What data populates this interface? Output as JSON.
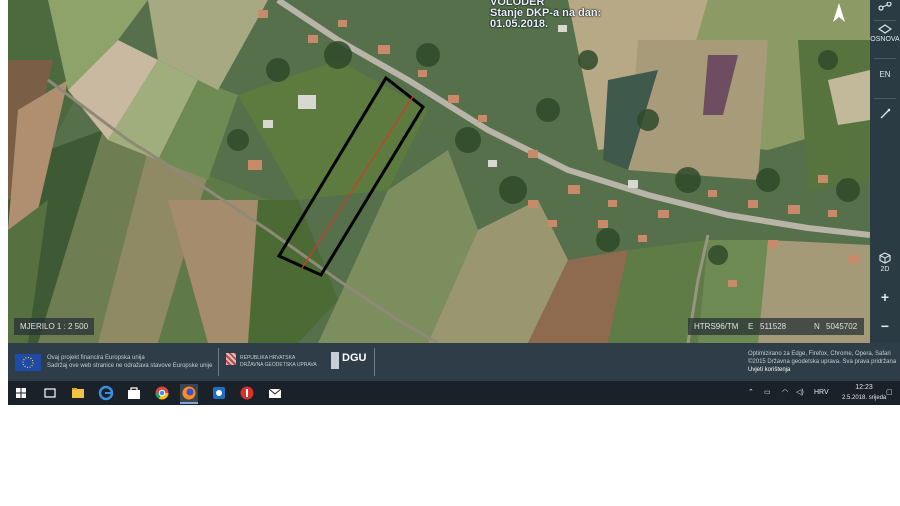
{
  "map": {
    "title_line1": "VOLODER",
    "title_line2": "Stanje DKP-a na dan:",
    "title_line3": "01.05.2018.",
    "scale_label": "MJERILO 1 : 2 500",
    "coords": {
      "crs": "HTRS96/TM",
      "e_label": "E",
      "e_value": "511528",
      "n_label": "N",
      "n_value": "5045702"
    },
    "parcel_outline_color": "#000000",
    "parcel_line_color": "#d4382a"
  },
  "toolbar": {
    "osnova_label": "OSNOVA",
    "lang_label": "EN",
    "view_label": "2D",
    "zoom_in": "+",
    "zoom_out": "−"
  },
  "footer": {
    "eu_line1": "Ovaj projekt financira Europska unija",
    "eu_line2": "Sadržaj ove web stranice ne odražava stavove Europske unije",
    "gov_line1": "REPUBLIKA HRVATSKA",
    "gov_line2": "DRŽAVNA GEODETSKA UPRAVA",
    "dgu_label": "DGU",
    "browser_note": "Optimizirano za Edge, Firefox, Chrome, Opera, Safari",
    "copyright": "©2015 Državna geodetska uprava. Sva prava pridržana",
    "terms": "Uvjeti korištenja"
  },
  "taskbar": {
    "lang": "HRV",
    "time": "12:23",
    "date": "2.5.2018. srijeda"
  },
  "colors": {
    "toolbar_bg": "#2b3b44",
    "footer_bg": "#2e3d47",
    "taskbar_bg": "#1a2129"
  }
}
